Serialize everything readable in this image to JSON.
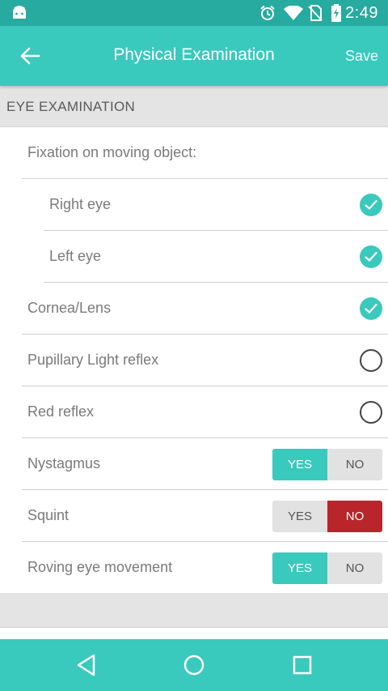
{
  "status_bar": {
    "time": "2:49",
    "icons": [
      "android-icon",
      "alarm-icon",
      "wifi-icon",
      "no-sim-icon",
      "battery-icon"
    ]
  },
  "app_bar": {
    "title": "Physical Examination",
    "save_label": "Save",
    "back_icon": "arrow-left-icon"
  },
  "section": {
    "title": "EYE EXAMINATION"
  },
  "rows": {
    "fixation": {
      "label": "Fixation on moving object:"
    },
    "right_eye": {
      "label": "Right eye",
      "checked": true
    },
    "left_eye": {
      "label": "Left eye",
      "checked": true
    },
    "cornea": {
      "label": "Cornea/Lens",
      "checked": true
    },
    "pupillary": {
      "label": "Pupillary Light reflex",
      "checked": false
    },
    "red_reflex": {
      "label": "Red reflex",
      "checked": false
    },
    "nystagmus": {
      "label": "Nystagmus",
      "yes": "YES",
      "no": "NO",
      "selected": "YES"
    },
    "squint": {
      "label": "Squint",
      "yes": "YES",
      "no": "NO",
      "selected": "NO"
    },
    "roving": {
      "label": "Roving eye movement",
      "yes": "YES",
      "no": "NO",
      "selected": "YES"
    }
  },
  "nav_bar": {
    "icons": [
      "back-triangle-icon",
      "home-circle-icon",
      "recents-square-icon"
    ]
  },
  "colors": {
    "accent": "#3ac9bd",
    "status_bar": "#27aa9f",
    "no_selected": "#b8262b",
    "section_bg": "#e4e4e4"
  }
}
